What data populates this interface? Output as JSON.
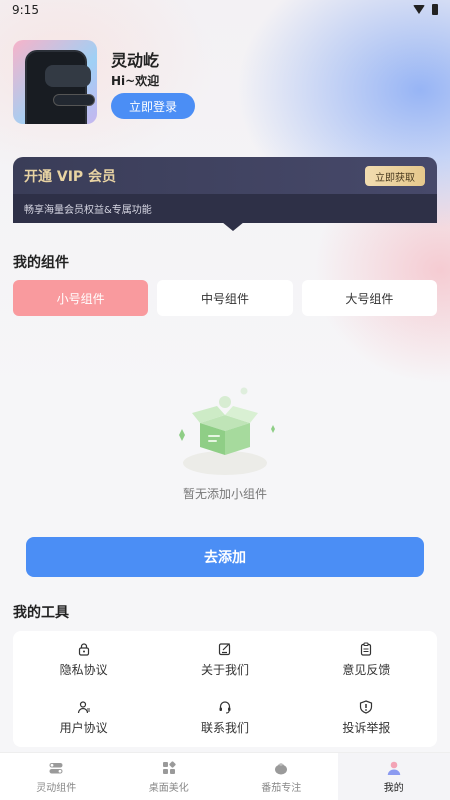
{
  "status_bar": {
    "time": "9:15"
  },
  "profile": {
    "app_name": "灵动屹",
    "greeting": "Hi~欢迎",
    "login_label": "立即登录"
  },
  "vip": {
    "title": "开通 VIP 会员",
    "get_label": "立即获取",
    "description": "畅享海量会员权益&专属功能"
  },
  "widgets": {
    "title": "我的组件",
    "tabs": [
      {
        "label": "小号组件",
        "active": true
      },
      {
        "label": "中号组件",
        "active": false
      },
      {
        "label": "大号组件",
        "active": false
      }
    ],
    "empty_text": "暂无添加小组件",
    "add_label": "去添加"
  },
  "tools": {
    "title": "我的工具",
    "items": [
      {
        "label": "隐私协议",
        "icon": "lock-icon"
      },
      {
        "label": "关于我们",
        "icon": "edit-icon"
      },
      {
        "label": "意见反馈",
        "icon": "clipboard-icon"
      },
      {
        "label": "用户协议",
        "icon": "user-icon"
      },
      {
        "label": "联系我们",
        "icon": "headset-icon"
      },
      {
        "label": "投诉举报",
        "icon": "alert-shield-icon"
      }
    ]
  },
  "bottom_nav": {
    "items": [
      {
        "label": "灵动组件",
        "icon": "toggle-icon",
        "active": false
      },
      {
        "label": "桌面美化",
        "icon": "grid-icon",
        "active": false
      },
      {
        "label": "番茄专注",
        "icon": "tomato-icon",
        "active": false
      },
      {
        "label": "我的",
        "icon": "person-icon",
        "active": true
      }
    ]
  },
  "colors": {
    "accent_blue": "#4b8ef5",
    "active_tab_pink": "#f99a9e",
    "vip_gold": "#e8d3a3"
  }
}
